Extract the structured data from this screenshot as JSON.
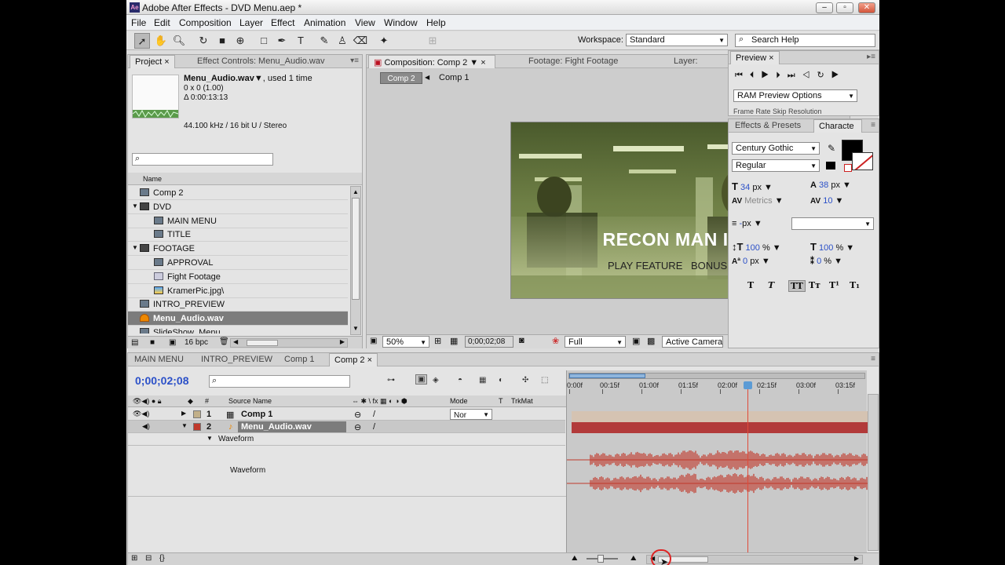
{
  "window": {
    "title": "Adobe After Effects - DVD Menu.aep *",
    "icon_label": "Ae"
  },
  "menu": [
    "File",
    "Edit",
    "Composition",
    "Layer",
    "Effect",
    "Animation",
    "View",
    "Window",
    "Help"
  ],
  "toolbar": {
    "workspace_label": "Workspace:",
    "workspace_value": "Standard",
    "search_placeholder": "Search Help"
  },
  "project": {
    "tabs": [
      "Project",
      "Effect Controls: Menu_Audio.wav"
    ],
    "item_name": "Menu_Audio.wav▼",
    "item_used": ", used 1 time",
    "item_size": "0 x 0 (1.00)",
    "item_duration": "Δ 0:00:13:13",
    "item_audio": "44.100 kHz / 16 bit U / Stereo",
    "column_name": "Name",
    "bpc": "16 bpc",
    "items": [
      {
        "label": "Comp 2",
        "type": "comp",
        "indent": 0,
        "twirl": ""
      },
      {
        "label": "DVD",
        "type": "folder",
        "indent": 0,
        "twirl": "▼"
      },
      {
        "label": "MAIN MENU",
        "type": "comp",
        "indent": 1,
        "twirl": ""
      },
      {
        "label": "TITLE",
        "type": "comp",
        "indent": 1,
        "twirl": ""
      },
      {
        "label": "FOOTAGE",
        "type": "folder",
        "indent": 0,
        "twirl": "▼"
      },
      {
        "label": "APPROVAL",
        "type": "comp",
        "indent": 1,
        "twirl": ""
      },
      {
        "label": "Fight Footage",
        "type": "foot",
        "indent": 1,
        "twirl": ""
      },
      {
        "label": "KramerPic.jpg\\",
        "type": "img",
        "indent": 1,
        "twirl": ""
      },
      {
        "label": "INTRO_PREVIEW",
        "type": "comp",
        "indent": 0,
        "twirl": ""
      },
      {
        "label": "Menu_Audio.wav",
        "type": "aud",
        "indent": 0,
        "twirl": "",
        "selected": true
      },
      {
        "label": "SlideShow_Menu",
        "type": "comp",
        "indent": 0,
        "twirl": ""
      }
    ]
  },
  "viewer": {
    "tabs": [
      "Composition: Comp 2",
      "Footage: Fight Footage",
      "Layer:"
    ],
    "breadcrumb": [
      "Comp 2",
      "Comp 1"
    ],
    "menu_title": "RECON MAN",
    "menu_title_num": "IV",
    "menu_options": [
      "PLAY FEATURE",
      "BONUS FEATURES"
    ],
    "zoom": "50%",
    "timecode": "0;00;02;08",
    "resolution": "Full",
    "camera": "Active Camera"
  },
  "preview": {
    "tab": "Preview",
    "ram_label": "RAM Preview Options",
    "cut_text": "Frame Rate    Skip      Resolution"
  },
  "character": {
    "tabs": [
      "Effects & Presets",
      "Characte"
    ],
    "font": "Century Gothic",
    "style": "Regular",
    "size": "34",
    "size_unit": "px",
    "leading": "38",
    "leading_unit": "px",
    "kerning": "Metrics",
    "tracking": "10",
    "stroke": "-",
    "stroke_unit": "px",
    "vscale": "100",
    "hscale": "100",
    "baseline": "0",
    "baseline_unit": "px",
    "tsume": "0",
    "pct": "%",
    "styles": [
      "T",
      "T",
      "TT",
      "Tт",
      "T¹",
      "T₁"
    ]
  },
  "timeline": {
    "tabs": [
      "MAIN MENU",
      "INTRO_PREVIEW",
      "Comp 1",
      "Comp 2"
    ],
    "timecode": "0;00;02;08",
    "col_source": "Source Name",
    "col_mode": "Mode",
    "col_t": "T",
    "col_trkmat": "TrkMat",
    "layers": [
      {
        "num": "1",
        "name": "Comp 1",
        "mode": "Nor"
      },
      {
        "num": "2",
        "name": "Menu_Audio.wav"
      }
    ],
    "waveform_label": "Waveform",
    "waveform_prop": "Waveform",
    "ruler": [
      "0:00f",
      "00:15f",
      "01:00f",
      "01:15f",
      "02:00f",
      "02:15f",
      "03:00f",
      "03:15f"
    ]
  },
  "colors": {
    "accent_blue": "#2b50c8",
    "layer1_bar": "#d5c3b2",
    "layer2_bar": "#b23a3a",
    "waveform": "#c0392b",
    "playhead": "#e04a3a"
  }
}
